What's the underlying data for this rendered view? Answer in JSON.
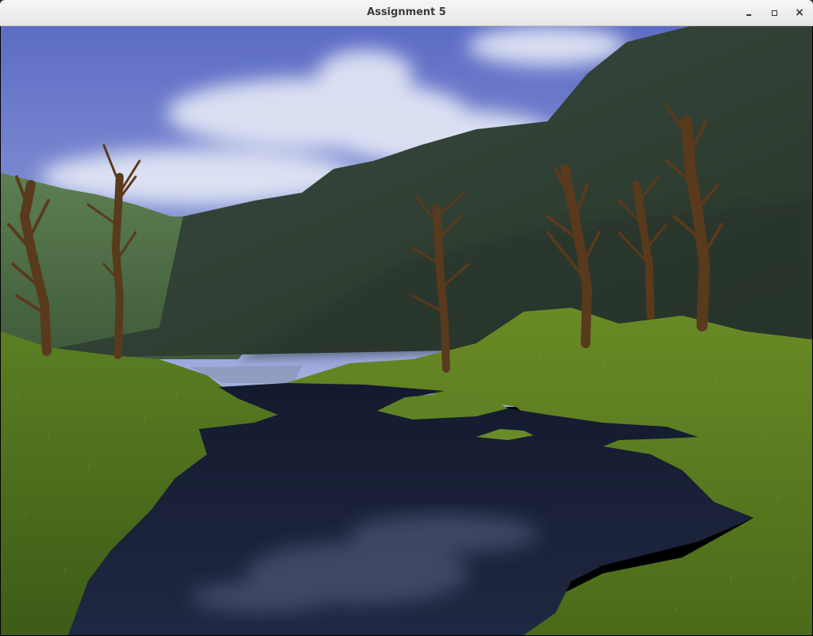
{
  "window": {
    "title": "Assignment 5",
    "controls": {
      "minimize_icon": "minimize-icon",
      "maximize_icon": "maximize-icon",
      "close_icon": "close-icon",
      "close_glyph": "×"
    }
  },
  "scene": {
    "colors": {
      "sky_top": "#5c6fc4",
      "sky_bottom": "#9aa7dd",
      "cloud": "#e8ecf8",
      "mountain_far": "#4f6a45",
      "mountain_near": "#2c3a31",
      "grass": "#5a7a22",
      "grass_dark": "#3c5618",
      "water": "#1b2238",
      "water_reflection": "#4a5472",
      "tree_bark": "#5a3a1c"
    }
  }
}
